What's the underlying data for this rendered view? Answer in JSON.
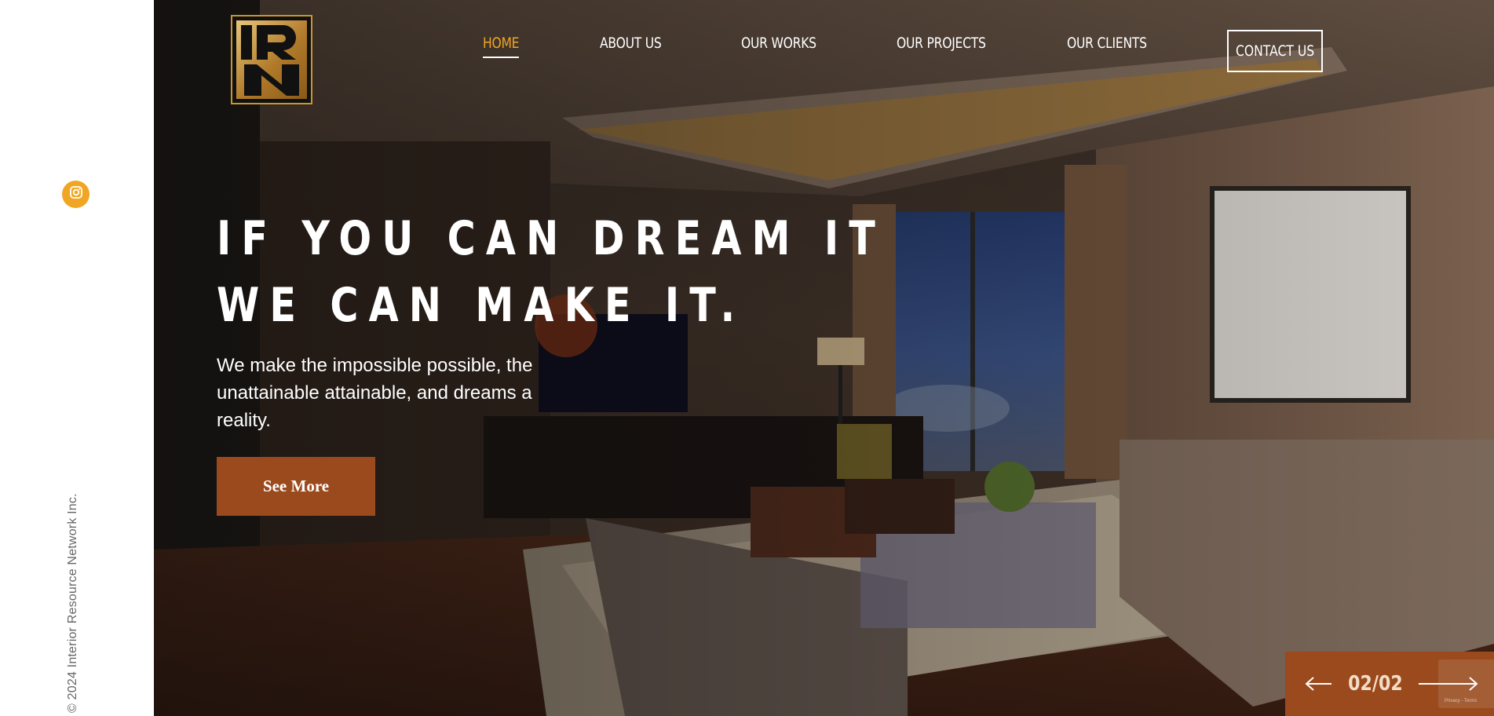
{
  "sidebar": {
    "instagram_icon": "instagram-icon",
    "copyright": "© 2024 Interior Resource Network Inc."
  },
  "logo": {
    "letters": "IRN",
    "alt": "IRN logo"
  },
  "nav": {
    "items": [
      {
        "label": "HOME",
        "active": true
      },
      {
        "label": "ABOUT US",
        "active": false
      },
      {
        "label": "OUR WORKS",
        "active": false
      },
      {
        "label": "OUR PROJECTS",
        "active": false
      },
      {
        "label": "OUR CLIENTS",
        "active": false
      }
    ],
    "contact_label": "CONTACT US"
  },
  "hero": {
    "headline_line1": "IF YOU CAN DREAM IT",
    "headline_line2": "WE CAN MAKE IT.",
    "subtext": "We make the impossible possible, the unattainable attainable, and dreams a reality.",
    "cta_label": "See More"
  },
  "slider": {
    "counter": "02/02",
    "prev_icon": "arrow-left-icon",
    "next_icon": "arrow-right-icon"
  },
  "recaptcha": {
    "text": "Privacy - Terms"
  },
  "colors": {
    "accent": "#f0a623",
    "cta": "#9a4a1c",
    "white": "#ffffff"
  }
}
